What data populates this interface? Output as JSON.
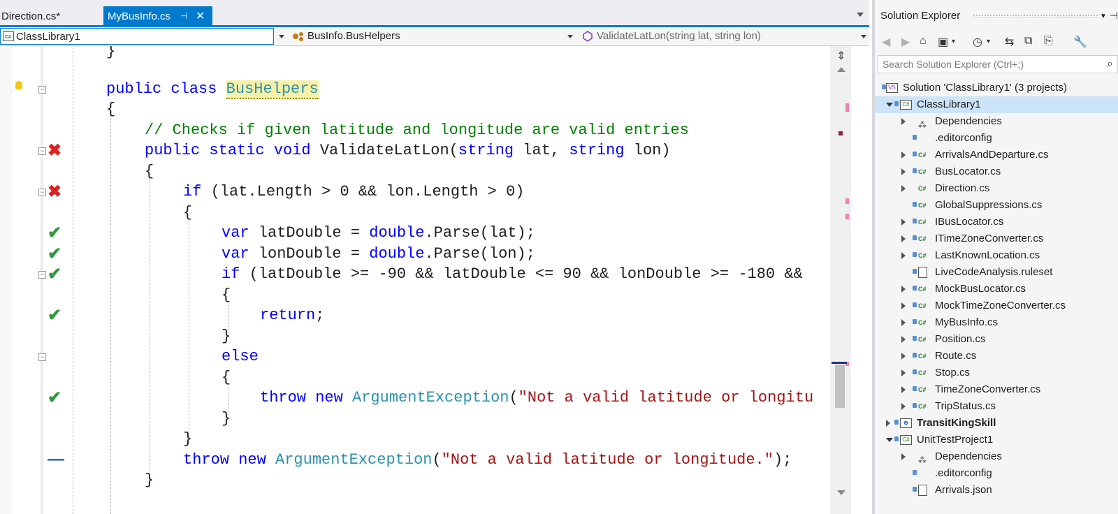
{
  "tabs": [
    {
      "label": "Direction.cs*"
    },
    {
      "label": "MyBusInfo.cs",
      "pin": "⊣",
      "close": "✕"
    }
  ],
  "nav": {
    "project": "ClassLibrary1",
    "type": "BusInfo.BusHelpers",
    "member": "ValidateLatLon(string lat, string lon)"
  },
  "code": {
    "l0": "}",
    "l1_kw": "public class ",
    "l1_name": "BusHelpers",
    "l2": "{",
    "l3": "// Checks if given latitude and longitude are valid entries",
    "l4_kw": "public static void ",
    "l4_name": "ValidateLatLon(",
    "l4_kw2": "string",
    "l4_mid": " lat, ",
    "l4_kw3": "string",
    "l4_end": " lon)",
    "l5": "{",
    "l6_kw": "if",
    "l6_rest": " (lat.Length > 0 && lon.Length > 0)",
    "l7": "{",
    "l8_kw": "var",
    "l8_mid": " latDouble = ",
    "l8_kw2": "double",
    "l8_end": ".Parse(lat);",
    "l9_kw": "var",
    "l9_mid": " lonDouble = ",
    "l9_kw2": "double",
    "l9_end": ".Parse(lon);",
    "l10_kw": "if",
    "l10_rest": " (latDouble >= -90 && latDouble <= 90 && lonDouble >= -180 &&",
    "l11": "{",
    "l12_kw": "return",
    "l12_end": ";",
    "l13": "}",
    "l14_kw": "else",
    "l15": "{",
    "l16_kw": "throw new ",
    "l16_ty": "ArgumentException",
    "l16_p": "(",
    "l16_st": "\"Not a valid latitude or longitu",
    "l17": "}",
    "l18": "}",
    "l19_kw": "throw new ",
    "l19_ty": "ArgumentException",
    "l19_p": "(",
    "l19_st": "\"Not a valid latitude or longitude.\"",
    "l19_end": ");",
    "l20": "}"
  },
  "glyphs": {
    "pass": "✔",
    "fail": "✖",
    "none": "—",
    "collapse": "−"
  },
  "solution_explorer": {
    "title": "Solution Explorer",
    "pin": "⊣",
    "close": "✕",
    "search_placeholder": "Search Solution Explorer (Ctrl+;)",
    "solution": "Solution 'ClassLibrary1' (3 projects)",
    "items": [
      {
        "label": "ClassLibrary1"
      },
      {
        "label": "Dependencies"
      },
      {
        "label": ".editorconfig"
      },
      {
        "label": "ArrivalsAndDeparture.cs"
      },
      {
        "label": "BusLocator.cs"
      },
      {
        "label": "Direction.cs"
      },
      {
        "label": "GlobalSuppressions.cs"
      },
      {
        "label": "IBusLocator.cs"
      },
      {
        "label": "ITimeZoneConverter.cs"
      },
      {
        "label": "LastKnownLocation.cs"
      },
      {
        "label": "LiveCodeAnalysis.ruleset"
      },
      {
        "label": "MockBusLocator.cs"
      },
      {
        "label": "MockTimeZoneConverter.cs"
      },
      {
        "label": "MyBusInfo.cs"
      },
      {
        "label": "Position.cs"
      },
      {
        "label": "Route.cs"
      },
      {
        "label": "Stop.cs"
      },
      {
        "label": "TimeZoneConverter.cs"
      },
      {
        "label": "TripStatus.cs"
      },
      {
        "label": "TransitKingSkill"
      },
      {
        "label": "UnitTestProject1"
      },
      {
        "label": "Dependencies"
      },
      {
        "label": ".editorconfig"
      },
      {
        "label": "Arrivals.json"
      }
    ]
  },
  "colors": {
    "accent": "#007acc",
    "pass": "#2e9a3a",
    "fail": "#e02020",
    "keyword": "#0000ff",
    "type": "#2b91af",
    "string": "#a31515",
    "comment": "#008000"
  }
}
